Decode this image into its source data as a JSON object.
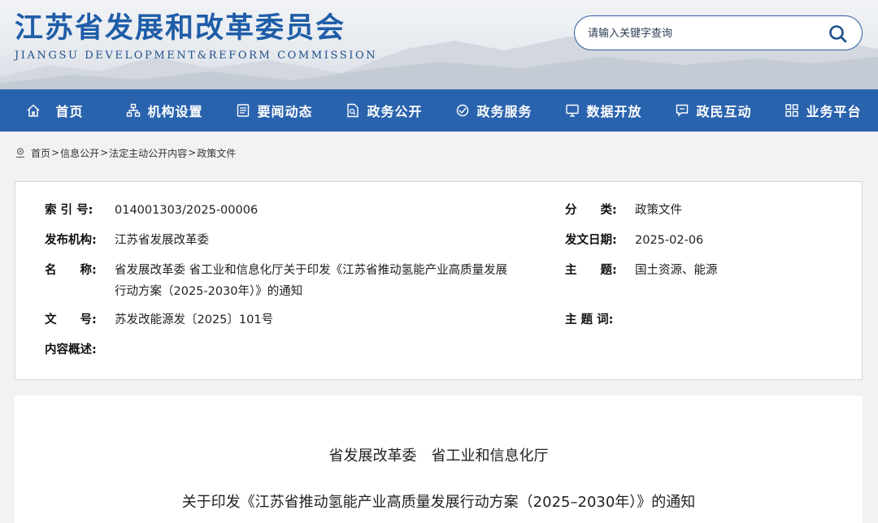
{
  "header": {
    "title_cn": "江苏省发展和改革委员会",
    "title_en": "JIANGSU DEVELOPMENT&REFORM COMMISSION",
    "search_placeholder": "请输入关键字查询"
  },
  "nav": {
    "items": [
      {
        "label": "首页",
        "icon": "home-icon"
      },
      {
        "label": "机构设置",
        "icon": "org-chart-icon"
      },
      {
        "label": "要闻动态",
        "icon": "news-icon"
      },
      {
        "label": "政务公开",
        "icon": "document-icon"
      },
      {
        "label": "政务服务",
        "icon": "service-icon"
      },
      {
        "label": "数据开放",
        "icon": "monitor-icon"
      },
      {
        "label": "政民互动",
        "icon": "chat-icon"
      },
      {
        "label": "业务平台",
        "icon": "grid-icon"
      }
    ]
  },
  "breadcrumb": {
    "items": [
      "首页",
      "信息公开",
      "法定主动公开内容",
      "政策文件"
    ],
    "separator": ">"
  },
  "info": {
    "index_label": "索 引 号:",
    "index_value": "014001303/2025-00006",
    "category_label": "分　　类:",
    "category_value": "政策文件",
    "publisher_label": "发布机构:",
    "publisher_value": "江苏省发展改革委",
    "date_label": "发文日期:",
    "date_value": "2025-02-06",
    "name_label": "名　　称:",
    "name_value_line1": "省发展改革委 省工业和信息化厅关于印发《江苏省推动氢能产业高质量发展",
    "name_value_line2": "行动方案（2025-2030年）》的通知",
    "topic_label": "主　　题:",
    "topic_value": "国土资源、能源",
    "docno_label": "文　　号:",
    "docno_value": "苏发改能源发〔2025〕101号",
    "keywords_label": "主 题 词:",
    "keywords_value": "",
    "summary_label": "内容概述:",
    "summary_value": ""
  },
  "article": {
    "issuer": "省发展改革委　省工业和信息化厅",
    "title": "关于印发《江苏省推动氢能产业高质量发展行动方案（2025–2030年）》的通知"
  },
  "colors": {
    "brand_blue": "#2a63ad",
    "title_blue": "#1f5da8"
  }
}
